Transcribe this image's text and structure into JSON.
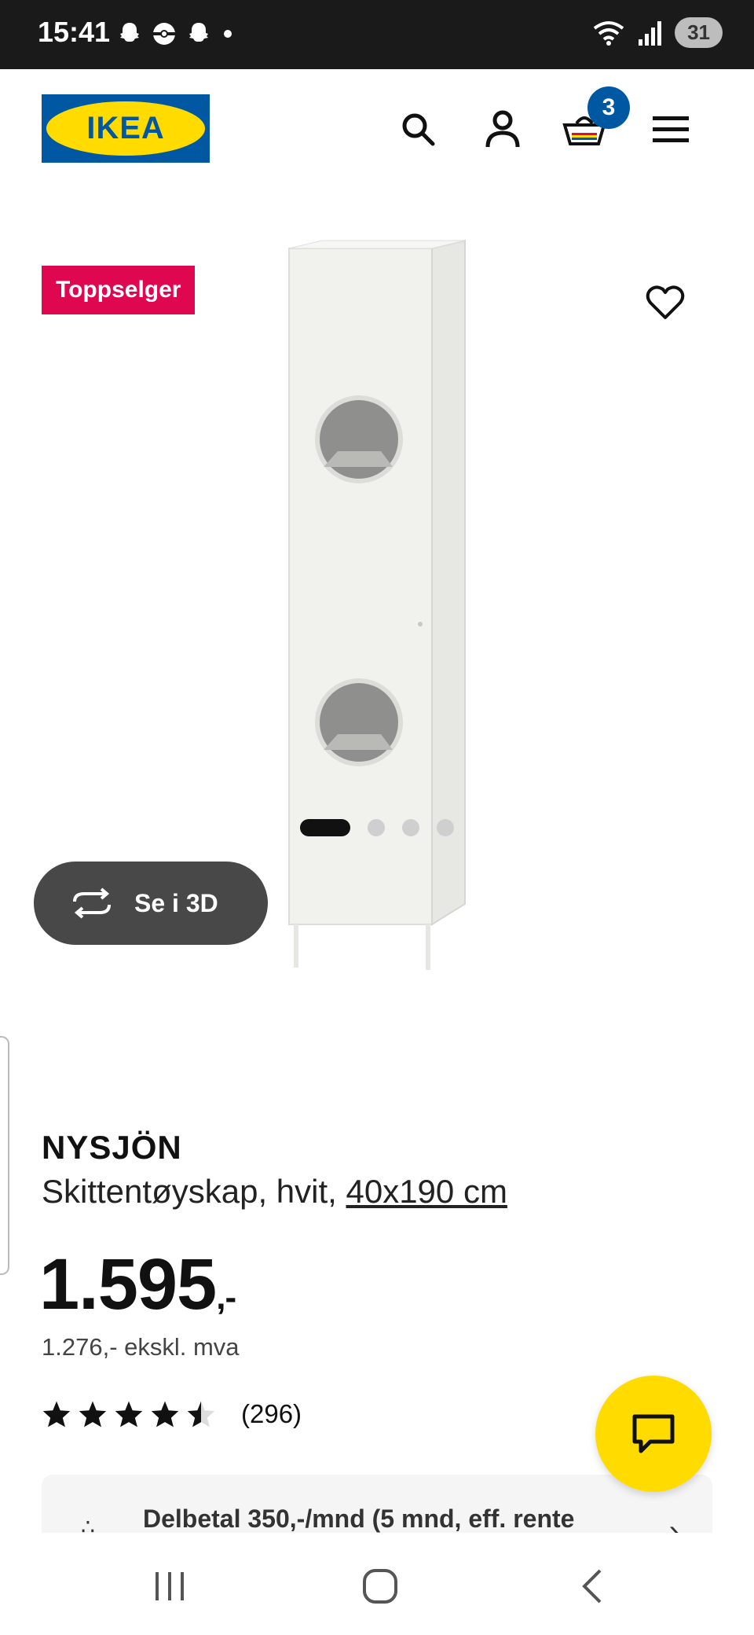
{
  "status_bar": {
    "time": "15:41",
    "battery": "31"
  },
  "header": {
    "logo_text": "IKEA",
    "cart_count": "3",
    "colors": {
      "brand_blue": "#0058a3",
      "brand_yellow": "#ffdb00"
    }
  },
  "product": {
    "badge": "Toppselger",
    "view_3d_label": "Se i 3D",
    "name": "NYSJÖN",
    "description_prefix": "Skittentøyskap, hvit, ",
    "size_link": "40x190 cm",
    "price_main": "1.595",
    "price_suffix": ",-",
    "price_ex_vat": "1.276,- ekskl. mva",
    "rating": 4.5,
    "rating_max": 5,
    "review_count": "(296)",
    "image_dots": {
      "count": 4,
      "active": 0
    }
  },
  "payment": {
    "text": "Delbetal 350,-/mnd (5 mnd, eff. rente"
  },
  "colors": {
    "badge_red": "#e00751",
    "button_dark": "#484848"
  }
}
